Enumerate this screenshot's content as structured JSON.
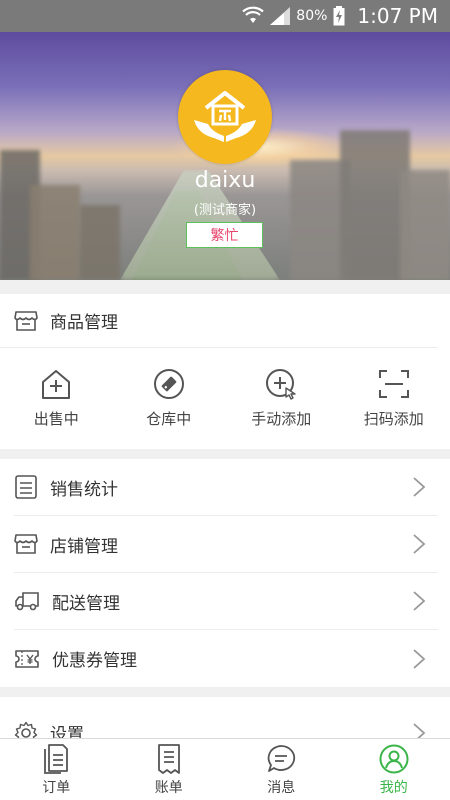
{
  "status_bar": {
    "battery": "80%",
    "time": "1:07 PM"
  },
  "profile": {
    "username": "daixu",
    "subtitle": "(测试商家)",
    "status": "繁忙"
  },
  "product_section": {
    "title": "商品管理",
    "actions": [
      {
        "label": "出售中",
        "icon": "house-plus-icon"
      },
      {
        "label": "仓库中",
        "icon": "tag-icon"
      },
      {
        "label": "手动添加",
        "icon": "add-touch-icon"
      },
      {
        "label": "扫码添加",
        "icon": "scan-icon"
      }
    ]
  },
  "menu": [
    {
      "label": "销售统计",
      "icon": "clipboard-list-icon"
    },
    {
      "label": "店铺管理",
      "icon": "store-icon"
    },
    {
      "label": "配送管理",
      "icon": "truck-icon"
    },
    {
      "label": "优惠券管理",
      "icon": "coupon-icon"
    }
  ],
  "settings": {
    "label": "设置",
    "icon": "gear-icon"
  },
  "bottom_nav": [
    {
      "label": "订单",
      "icon": "order-icon"
    },
    {
      "label": "账单",
      "icon": "bill-icon"
    },
    {
      "label": "消息",
      "icon": "message-icon"
    },
    {
      "label": "我的",
      "icon": "profile-icon",
      "active": true
    }
  ],
  "colors": {
    "accent": "#3bb54a",
    "badge_text": "#e8436b",
    "avatar_bg": "#f5b81f"
  }
}
